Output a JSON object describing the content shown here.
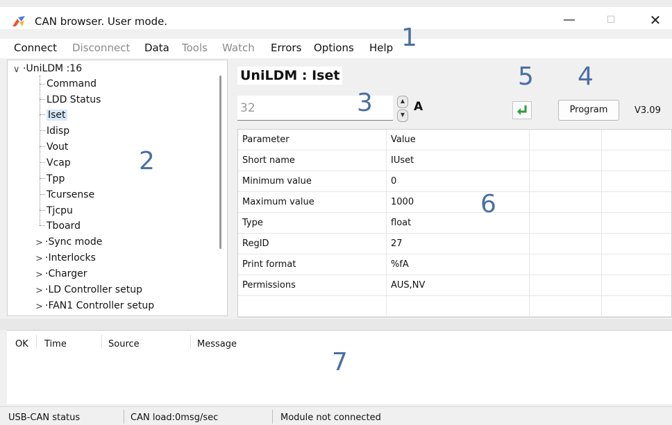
{
  "window": {
    "title": "CAN browser. User mode.",
    "min_glyph": "—",
    "max_glyph": "☐",
    "close_glyph": "✕"
  },
  "menu": {
    "connect": "Connect",
    "disconnect": "Disconnect",
    "data": "Data",
    "tools": "Tools",
    "watch": "Watch",
    "errors": "Errors",
    "options": "Options",
    "help": "Help"
  },
  "tree": {
    "root": "UniLDM  :16",
    "children": [
      "Command",
      "LDD Status",
      "Iset",
      "Idisp",
      "Vout",
      "Vcap",
      "Tpp",
      "Tcursense",
      "Tjcpu",
      "Tboard"
    ],
    "selected": "Iset",
    "groups": [
      "Sync mode",
      "Interlocks",
      "Charger",
      "LD Controller setup",
      "FAN1 Controller setup"
    ]
  },
  "param": {
    "title": "UniLDM  : Iset",
    "value": "32",
    "unit": "A",
    "program_label": "Program",
    "version": "V3.09"
  },
  "grid": {
    "header": [
      "Parameter",
      "Value"
    ],
    "rows": [
      [
        "Short name",
        "IUset"
      ],
      [
        "Minimum value",
        "0"
      ],
      [
        "Maximum value",
        "1000"
      ],
      [
        "Type",
        "float"
      ],
      [
        "RegID",
        "27"
      ],
      [
        "Print format",
        "%fA"
      ],
      [
        "Permissions",
        "AUS,NV"
      ]
    ]
  },
  "log": {
    "columns": [
      "OK",
      "Time",
      "Source",
      "Message"
    ]
  },
  "status": {
    "usb": "USB-CAN status",
    "load": "CAN load:0msg/sec",
    "module": "Module not connected"
  },
  "callouts": [
    "1",
    "2",
    "3",
    "4",
    "5",
    "6",
    "7"
  ],
  "colors": {
    "callout": "#4a6fa5",
    "enter_icon": "#2e9e3a",
    "selection": "#d6e8fb"
  }
}
